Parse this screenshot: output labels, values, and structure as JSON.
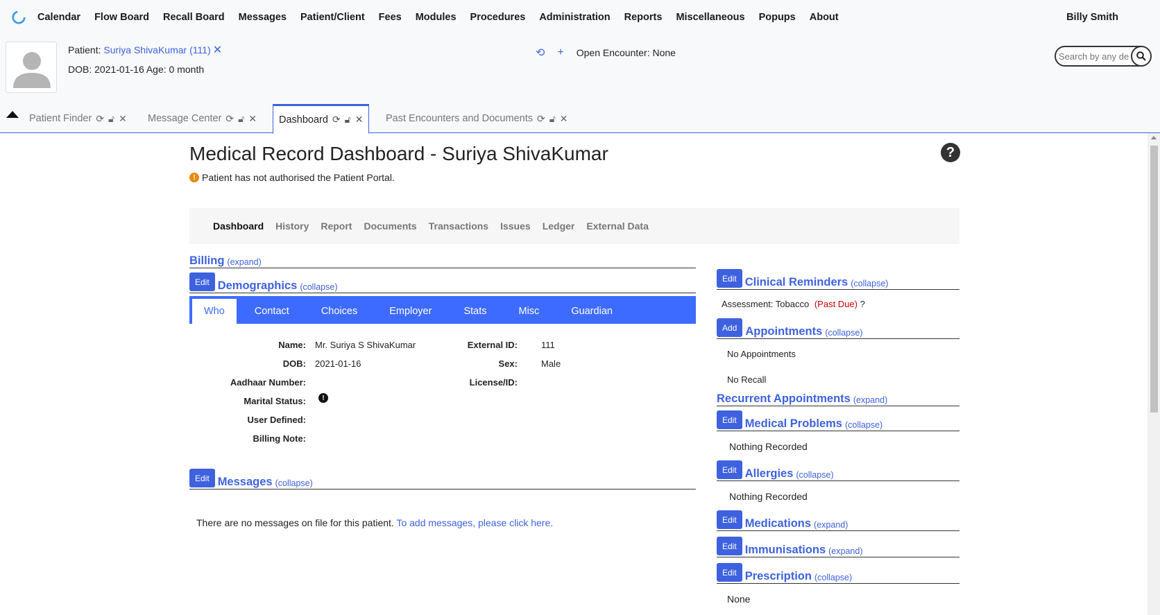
{
  "nav": {
    "items": [
      "Calendar",
      "Flow Board",
      "Recall Board",
      "Messages",
      "Patient/Client",
      "Fees",
      "Modules",
      "Procedures",
      "Administration",
      "Reports",
      "Miscellaneous",
      "Popups",
      "About"
    ],
    "user": "Billy Smith"
  },
  "patient": {
    "label": "Patient:",
    "name": "Suriya ShivaKumar (111)",
    "close": "✕",
    "dob_line": "DOB: 2021-01-16 Age: 0 month"
  },
  "encounter": {
    "text": "Open Encounter: None"
  },
  "search": {
    "placeholder": "Search by any demographics"
  },
  "tabs": [
    {
      "label": "Patient Finder"
    },
    {
      "label": "Message Center"
    },
    {
      "label": "Dashboard"
    },
    {
      "label": "Past Encounters and Documents"
    }
  ],
  "dashboard": {
    "title": "Medical Record Dashboard - Suriya ShivaKumar",
    "help": "?",
    "portal_warning": "Patient has not authorised the Patient Portal.",
    "subnav": [
      "Dashboard",
      "History",
      "Report",
      "Documents",
      "Transactions",
      "Issues",
      "Ledger",
      "External Data"
    ]
  },
  "billing": {
    "title": "Billing",
    "toggle": "(expand)"
  },
  "demographics": {
    "edit": "Edit",
    "title": "Demographics",
    "toggle": "(collapse)",
    "tabs": [
      "Who",
      "Contact",
      "Choices",
      "Employer",
      "Stats",
      "Misc",
      "Guardian"
    ],
    "fields_left": [
      {
        "label": "Name:",
        "value": "Mr. Suriya S ShivaKumar"
      },
      {
        "label": "DOB:",
        "value": "2021-01-16"
      },
      {
        "label": "Aadhaar Number:",
        "value": ""
      },
      {
        "label": "Marital Status:",
        "value": ""
      },
      {
        "label": "User Defined:",
        "value": ""
      },
      {
        "label": "Billing Note:",
        "value": ""
      }
    ],
    "fields_right": [
      {
        "label": "External ID:",
        "value": "111"
      },
      {
        "label": "Sex:",
        "value": "Male"
      },
      {
        "label": "License/ID:",
        "value": ""
      }
    ]
  },
  "messages": {
    "edit": "Edit",
    "title": "Messages",
    "toggle": "(collapse)",
    "body": "There are no messages on file for this patient.",
    "link": "To add messages, please click here."
  },
  "right": {
    "reminders": {
      "edit": "Edit",
      "title": "Clinical Reminders",
      "toggle": "(collapse)",
      "item_prefix": "Assessment: Tobacco",
      "item_status": "(Past Due)",
      "item_suffix": "?"
    },
    "appointments": {
      "edit": "Add",
      "title": "Appointments",
      "toggle": "(collapse)",
      "none": "No Appointments",
      "recall": "No Recall"
    },
    "recurrent": {
      "title": "Recurrent Appointments",
      "toggle": "(expand)"
    },
    "problems": {
      "edit": "Edit",
      "title": "Medical Problems",
      "toggle": "(collapse)",
      "body": "Nothing Recorded"
    },
    "allergies": {
      "edit": "Edit",
      "title": "Allergies",
      "toggle": "(collapse)",
      "body": "Nothing Recorded"
    },
    "medications": {
      "edit": "Edit",
      "title": "Medications",
      "toggle": "(expand)"
    },
    "immunisations": {
      "edit": "Edit",
      "title": "Immunisations",
      "toggle": "(expand)"
    },
    "prescription": {
      "edit": "Edit",
      "title": "Prescription",
      "toggle": "(collapse)",
      "body": "None"
    }
  },
  "colors": {
    "accent": "#3e62de",
    "tabs_bg": "#3e6bff",
    "warning": "#e8890c",
    "past_due": "#d00000"
  }
}
